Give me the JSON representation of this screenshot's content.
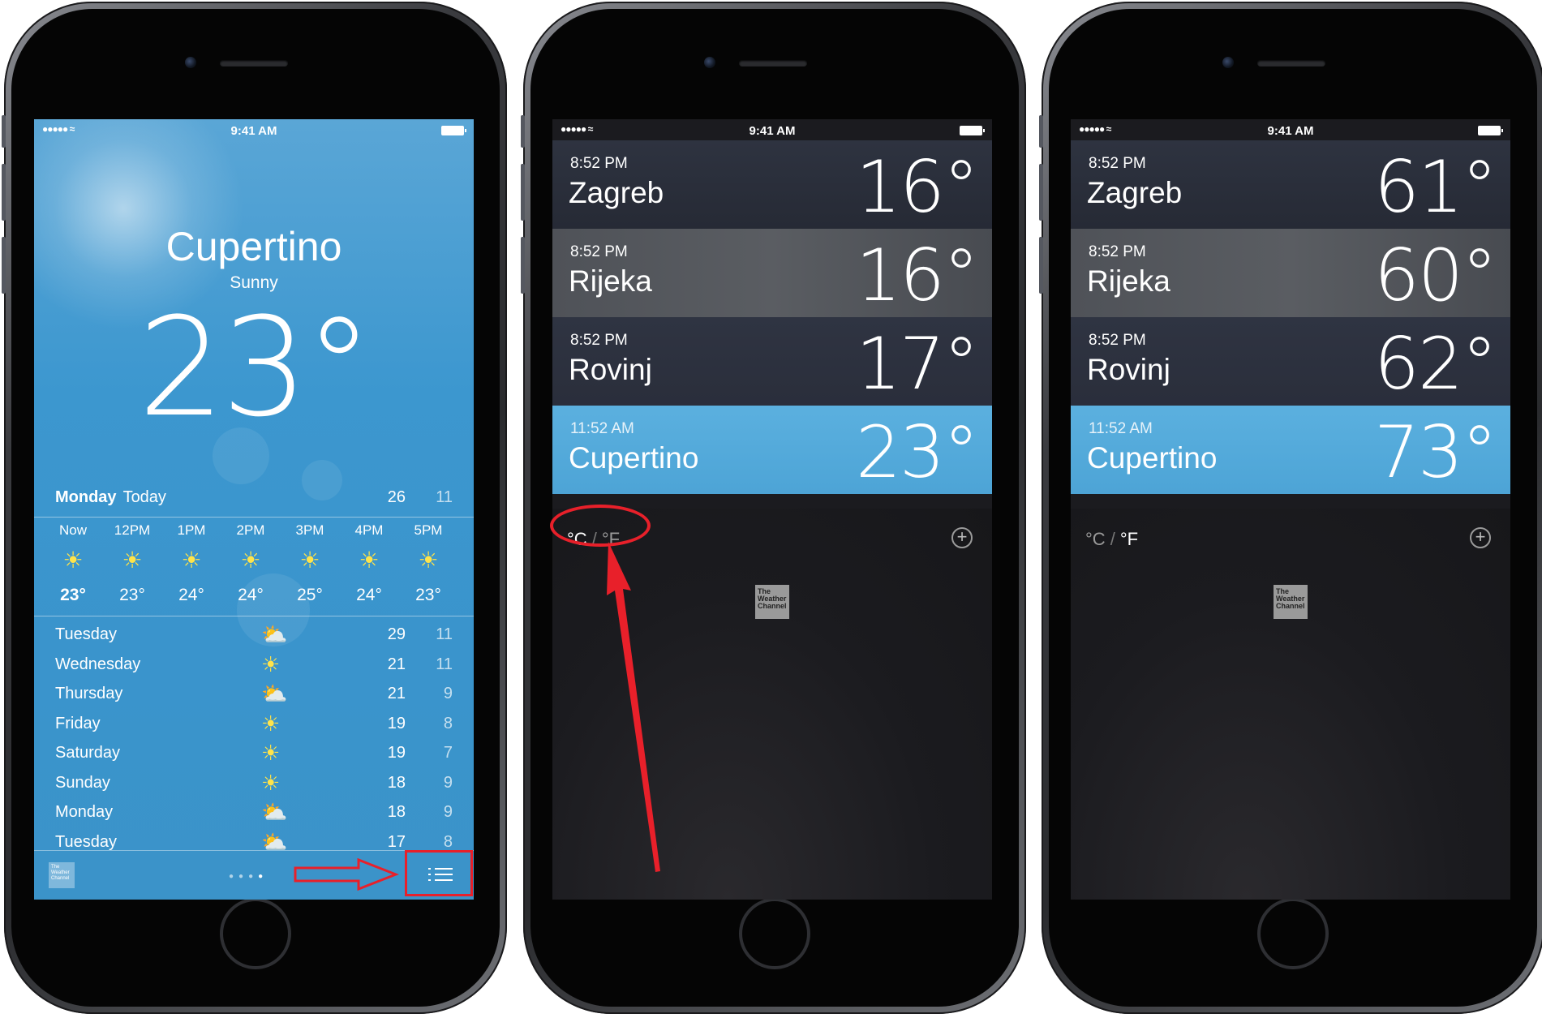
{
  "status_bar": {
    "time": "9:41 AM",
    "signal": "●●●●● ≈"
  },
  "detail": {
    "city": "Cupertino",
    "condition": "Sunny",
    "temp": "23°",
    "today": {
      "day": "Monday",
      "label": "Today",
      "high": "26",
      "low": "11"
    },
    "hourly": [
      {
        "time": "Now",
        "icon": "sun-icon",
        "temp": "23°"
      },
      {
        "time": "12PM",
        "icon": "sun-icon",
        "temp": "23°"
      },
      {
        "time": "1PM",
        "icon": "sun-icon",
        "temp": "24°"
      },
      {
        "time": "2PM",
        "icon": "sun-icon",
        "temp": "24°"
      },
      {
        "time": "3PM",
        "icon": "sun-icon",
        "temp": "25°"
      },
      {
        "time": "4PM",
        "icon": "sun-icon",
        "temp": "24°"
      },
      {
        "time": "5PM",
        "icon": "sun-icon",
        "temp": "23°"
      }
    ],
    "daily": [
      {
        "day": "Tuesday",
        "icon": "partly-cloudy-icon",
        "high": "29",
        "low": "11"
      },
      {
        "day": "Wednesday",
        "icon": "sun-icon",
        "high": "21",
        "low": "11"
      },
      {
        "day": "Thursday",
        "icon": "partly-cloudy-icon",
        "high": "21",
        "low": "9"
      },
      {
        "day": "Friday",
        "icon": "sun-icon",
        "high": "19",
        "low": "8"
      },
      {
        "day": "Saturday",
        "icon": "sun-icon",
        "high": "19",
        "low": "7"
      },
      {
        "day": "Sunday",
        "icon": "sun-icon",
        "high": "18",
        "low": "9"
      },
      {
        "day": "Monday",
        "icon": "partly-cloudy-icon",
        "high": "18",
        "low": "9"
      },
      {
        "day": "Tuesday",
        "icon": "partly-cloudy-icon",
        "high": "17",
        "low": "8"
      }
    ],
    "logo_text": "The Weather Channel"
  },
  "list_celsius": {
    "rows": [
      {
        "time": "8:52 PM",
        "city": "Zagreb",
        "temp": "16°"
      },
      {
        "time": "8:52 PM",
        "city": "Rijeka",
        "temp": "16°"
      },
      {
        "time": "8:52 PM",
        "city": "Rovinj",
        "temp": "17°"
      },
      {
        "time": "11:52 AM",
        "city": "Cupertino",
        "temp": "23°"
      }
    ],
    "unit_c": "°C",
    "unit_sep": "/",
    "unit_f": "°F",
    "logo_text": "The Weather Channel"
  },
  "list_fahrenheit": {
    "rows": [
      {
        "time": "8:52 PM",
        "city": "Zagreb",
        "temp": "61°"
      },
      {
        "time": "8:52 PM",
        "city": "Rijeka",
        "temp": "60°"
      },
      {
        "time": "8:52 PM",
        "city": "Rovinj",
        "temp": "62°"
      },
      {
        "time": "11:52 AM",
        "city": "Cupertino",
        "temp": "73°"
      }
    ],
    "unit_c": "°C",
    "unit_sep": "/",
    "unit_f": "°F",
    "logo_text": "The Weather Channel"
  },
  "colors": {
    "sky_blue": "#3b93c9",
    "annotation_red": "#e8202a",
    "selected_row": "#4da4d6"
  }
}
